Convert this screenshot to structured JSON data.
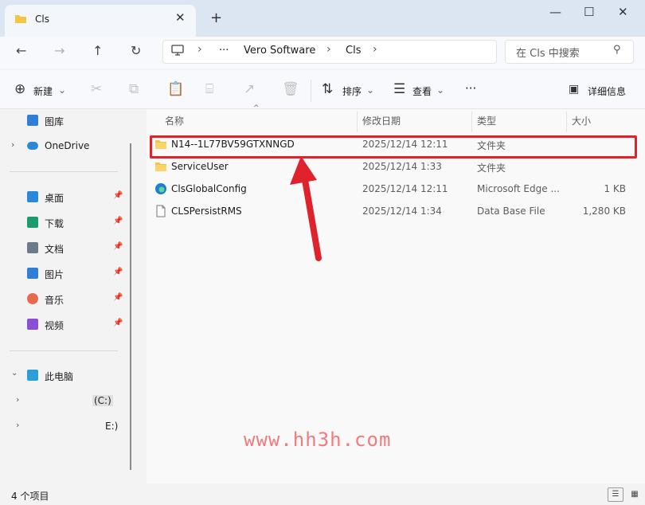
{
  "window": {
    "tab_title": "Cls",
    "new_tab": "+",
    "close_tab": "✕",
    "minimize": "—",
    "maximize": "☐",
    "close": "✕"
  },
  "address": {
    "more": "···",
    "crumbs": [
      "Vero Software",
      "Cls"
    ],
    "search_placeholder": "在 Cls 中搜索"
  },
  "toolbar": {
    "new_label": "新建",
    "sort_label": "排序",
    "view_label": "查看",
    "more": "···",
    "details_label": "详细信息"
  },
  "sidebar": {
    "gallery": "图库",
    "onedrive": "OneDrive",
    "quick": [
      {
        "label": "桌面",
        "color": "#2b88d8"
      },
      {
        "label": "下载",
        "color": "#1a9b6e"
      },
      {
        "label": "文档",
        "color": "#6b7b8c"
      },
      {
        "label": "图片",
        "color": "#2f7fd6"
      },
      {
        "label": "音乐",
        "color": "#e46c4c"
      },
      {
        "label": "视频",
        "color": "#8a4fd3"
      }
    ],
    "this_pc": "此电脑",
    "drives": [
      "(C:)",
      "E:)"
    ]
  },
  "columns": {
    "name": "名称",
    "modified": "修改日期",
    "type": "类型",
    "size": "大小"
  },
  "files": [
    {
      "name": "N14--1L77BV59GTXNNGD",
      "modified": "2025/12/14 12:11",
      "type": "文件夹",
      "size": "",
      "icon": "folder-icon"
    },
    {
      "name": "ServiceUser",
      "modified": "2025/12/14 1:33",
      "type": "文件夹",
      "size": "",
      "icon": "folder-icon"
    },
    {
      "name": "ClsGlobalConfig",
      "modified": "2025/12/14 12:11",
      "type": "Microsoft Edge ...",
      "size": "1 KB",
      "icon": "edge-icon"
    },
    {
      "name": "CLSPersistRMS",
      "modified": "2025/12/14 1:34",
      "type": "Data Base File",
      "size": "1,280 KB",
      "icon": "file-icon"
    }
  ],
  "status": {
    "count": "4 个项目"
  },
  "watermark": "www.hh3h.com",
  "colors": {
    "highlight": "#e0222d",
    "arrow": "#e0222d",
    "folder": "#f6c445"
  }
}
